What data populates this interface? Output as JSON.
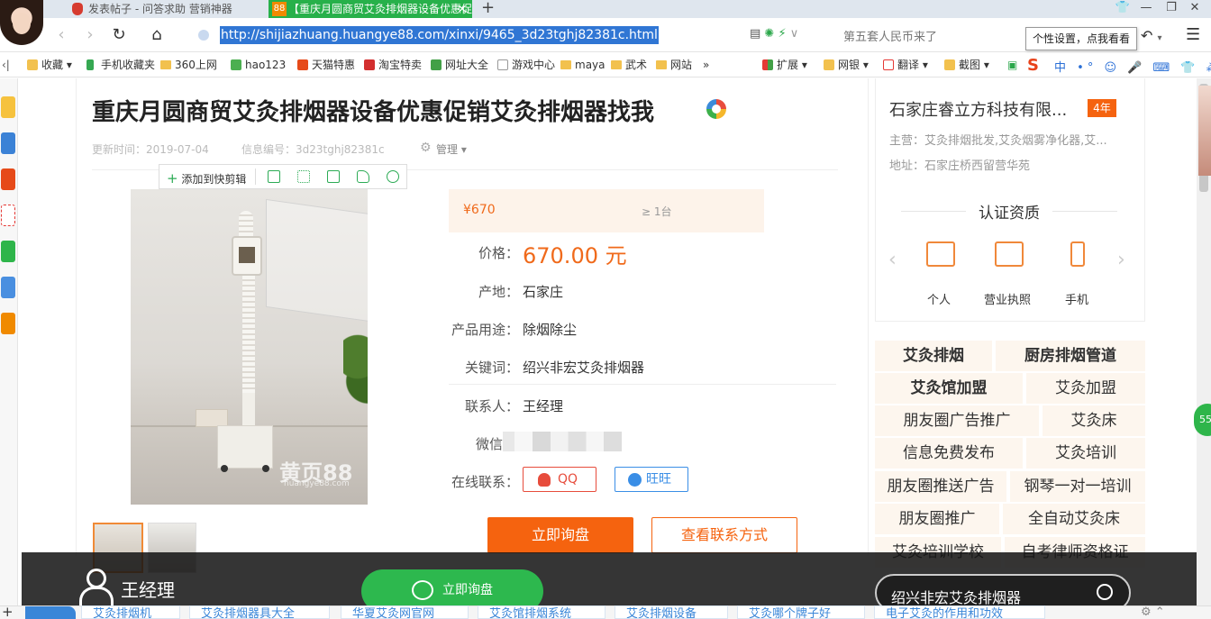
{
  "browser": {
    "tabs": [
      {
        "label": "发表帖子 - 问答求助 营销神器",
        "active": false
      },
      {
        "label": "【重庆月圆商贸艾灸排烟器设备优惠促销艾灸排烟器找我】",
        "active": true,
        "icon_text": "88"
      }
    ],
    "url": "http://shijiazhuang.huangye88.com/xinxi/9465_3d23tghj82381c.html",
    "news_text": "第五套人民币来了",
    "tooltip": "个性设置，点我看看",
    "accent_color": "#27b04a"
  },
  "bookmarks": [
    {
      "label": "收藏",
      "icon": "star-icon"
    },
    {
      "label": "手机收藏夹",
      "icon": "phone-icon"
    },
    {
      "label": "360上网",
      "icon": "folder-icon"
    },
    {
      "label": "hao123",
      "icon": "hao123-icon"
    },
    {
      "label": "天猫特惠",
      "icon": "tmall-icon"
    },
    {
      "label": "淘宝特卖",
      "icon": "taobao-icon"
    },
    {
      "label": "网址大全",
      "icon": "hao-icon"
    },
    {
      "label": "游戏中心",
      "icon": "game-icon"
    },
    {
      "label": "maya",
      "icon": "folder-icon"
    },
    {
      "label": "武术",
      "icon": "folder-icon"
    },
    {
      "label": "网站",
      "icon": "folder-icon"
    },
    {
      "label": "扩展",
      "icon": "extension-icon"
    },
    {
      "label": "网银",
      "icon": "bank-icon"
    },
    {
      "label": "翻译",
      "icon": "translate-icon"
    },
    {
      "label": "截图",
      "icon": "screenshot-icon"
    }
  ],
  "ime": {
    "label": "中"
  },
  "product": {
    "title": "重庆月圆商贸艾灸排烟器设备优惠促销艾灸排烟器找我",
    "updated_label": "更新时间：2019-07-04",
    "info_no_label": "信息编号：3d23tghj82381c",
    "manage_label": "管理",
    "clip_add_label": "添加到快剪辑",
    "price_small": "¥670",
    "min_order": "≥ 1台",
    "fields": [
      {
        "label": "价格：",
        "value": "670.00 元"
      },
      {
        "label": "产地：",
        "value": "石家庄"
      },
      {
        "label": "产品用途：",
        "value": "除烟除尘"
      },
      {
        "label": "关键词：",
        "value": "绍兴非宏艾灸排烟器"
      },
      {
        "label": "联系人：",
        "value": "王经理"
      },
      {
        "label": "微信",
        "value": ""
      },
      {
        "label": "在线联系：",
        "value": ""
      }
    ],
    "qq_label": "QQ",
    "wangwang_label": "旺旺",
    "inquire_label": "立即询盘",
    "contact_label": "查看联系方式",
    "watermark": "黄页88",
    "watermark_sub": "huangye88.com",
    "price_color": "#f06a1b"
  },
  "company": {
    "name": "石家庄睿立方科技有限...",
    "years": "4年",
    "main_business": "主营：艾灸排烟批发,艾灸烟雾净化器,艾...",
    "address": "地址：石家庄桥西留营华苑",
    "cert_title": "认证资质",
    "certs": [
      "个人",
      "营业执照",
      "手机"
    ]
  },
  "tags": [
    [
      "艾灸排烟",
      "厨房排烟管道"
    ],
    [
      "艾灸馆加盟",
      "艾灸加盟"
    ],
    [
      "朋友圈广告推广",
      "艾灸床"
    ],
    [
      "信息免费发布",
      "艾灸培训"
    ],
    [
      "朋友圈推送广告",
      "钢琴一对一培训"
    ],
    [
      "朋友圈推广",
      "全自动艾灸床"
    ],
    [
      "艾灸培训学校",
      "自考律师资格证"
    ]
  ],
  "overlay": {
    "contact_name": "王经理",
    "inquire_label": "立即询盘",
    "search_text": "绍兴非宏艾灸排烟器"
  },
  "bottom_links": [
    "艾灸排烟机",
    "艾灸排烟器具大全",
    "华夏艾灸网官网",
    "艾灸馆排烟系统",
    "艾灸排烟设备",
    "艾灸哪个牌子好",
    "电子艾灸的作用和功效"
  ],
  "float_badge": "55"
}
